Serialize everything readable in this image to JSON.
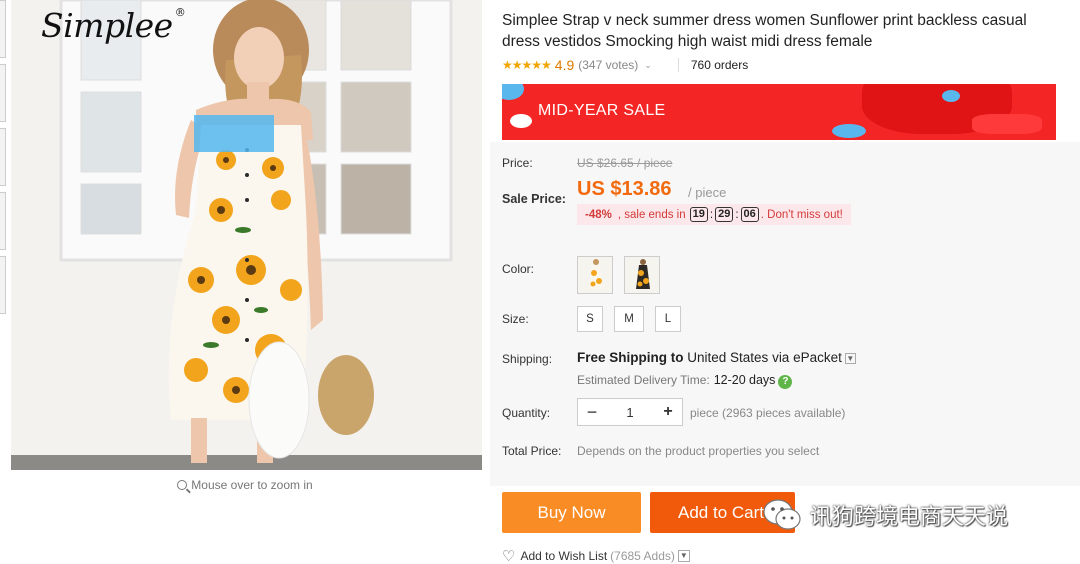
{
  "brand": {
    "logo_text": "Simplee",
    "trademark": "®"
  },
  "gallery": {
    "zoom_hint": "Mouse over to zoom in"
  },
  "product": {
    "title": "Simplee Strap v neck summer dress women Sunflower print backless casual dress vestidos Smocking high waist midi dress female",
    "stars": "★★★★★",
    "rating": "4.9",
    "votes": "(347 votes)",
    "orders": "760 orders"
  },
  "banner": {
    "text": "MID-YEAR SALE",
    "color": "#f42525"
  },
  "pricing": {
    "price_label": "Price:",
    "original_price": "US $26.65 / piece",
    "sale_label": "Sale Price:",
    "sale_price": "US $13.86",
    "per_piece": "/ piece",
    "discount": "-48%",
    "sale_ends_text": ", sale ends in",
    "timer": {
      "hours": "19",
      "sep1": ":",
      "minutes": "29",
      "sep2": ":",
      "seconds": "06"
    },
    "urgency": ". Don't miss out!",
    "accent_color": "#f26a0d"
  },
  "options": {
    "color_label": "Color:",
    "colors": [
      "white-sunflower",
      "black-sunflower"
    ],
    "size_label": "Size:",
    "sizes": [
      "S",
      "M",
      "L"
    ]
  },
  "shipping": {
    "label": "Shipping:",
    "free_text": "Free Shipping to",
    "destination": "United States via ePacket",
    "delivery_label": "Estimated Delivery Time:",
    "delivery_days": "12-20",
    "days_word": "days",
    "help_icon": "?"
  },
  "quantity": {
    "label": "Quantity:",
    "minus": "−",
    "value": "1",
    "plus": "+",
    "available": "piece (2963 pieces available)"
  },
  "total": {
    "label": "Total Price:",
    "value": "Depends on the product properties you select"
  },
  "actions": {
    "buy_now": "Buy Now",
    "add_to_cart": "Add to Cart",
    "wishlist": "Add to Wish List",
    "wishlist_count": "(7685 Adds)"
  },
  "watermark": {
    "text": "讯狗跨境电商天天说"
  }
}
